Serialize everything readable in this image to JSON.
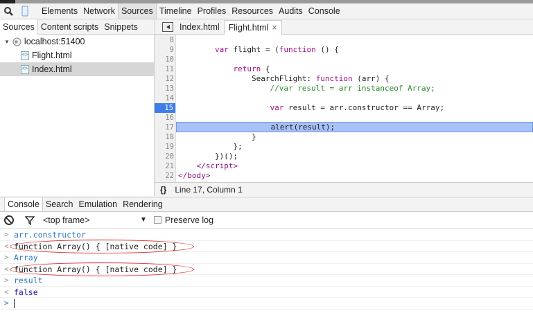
{
  "toolbar": {
    "tabs": [
      "Elements",
      "Network",
      "Sources",
      "Timeline",
      "Profiles",
      "Resources",
      "Audits",
      "Console"
    ],
    "active": "Sources"
  },
  "navigator": {
    "tabs": [
      "Sources",
      "Content scripts",
      "Snippets"
    ],
    "host": "localhost:51400",
    "files": [
      "Flight.html",
      "Index.html"
    ],
    "selected": "Index.html"
  },
  "editor": {
    "tabs": [
      "Index.html",
      "Flight.html"
    ],
    "active": "Flight.html",
    "close_glyph": "×",
    "breakpoint_line": 15,
    "execution_line": 17,
    "lines": [
      {
        "n": "8",
        "seg": []
      },
      {
        "n": "9",
        "seg": [
          [
            "p",
            "        "
          ],
          [
            "k",
            "var"
          ],
          [
            "p",
            " flight = ("
          ],
          [
            "k",
            "function"
          ],
          [
            "p",
            " () {"
          ]
        ]
      },
      {
        "n": "10",
        "seg": []
      },
      {
        "n": "11",
        "seg": [
          [
            "p",
            "            "
          ],
          [
            "k",
            "return"
          ],
          [
            "p",
            " {"
          ]
        ]
      },
      {
        "n": "12",
        "seg": [
          [
            "p",
            "                SearchFlight: "
          ],
          [
            "k",
            "function"
          ],
          [
            "p",
            " (arr) {"
          ]
        ]
      },
      {
        "n": "13",
        "seg": [
          [
            "p",
            "                    "
          ],
          [
            "c",
            "//var result = arr instanceof Array;"
          ]
        ]
      },
      {
        "n": "14",
        "seg": []
      },
      {
        "n": "15",
        "seg": [
          [
            "p",
            "                    "
          ],
          [
            "k",
            "var"
          ],
          [
            "p",
            " result = arr.constructor == Array;"
          ]
        ]
      },
      {
        "n": "16",
        "seg": []
      },
      {
        "n": "17",
        "seg": [
          [
            "p",
            "                    alert(result);"
          ]
        ]
      },
      {
        "n": "18",
        "seg": [
          [
            "p",
            "                }"
          ]
        ]
      },
      {
        "n": "19",
        "seg": [
          [
            "p",
            "            };"
          ]
        ]
      },
      {
        "n": "20",
        "seg": [
          [
            "p",
            "        })();"
          ]
        ]
      },
      {
        "n": "21",
        "seg": [
          [
            "p",
            "    "
          ],
          [
            "t",
            "</script>"
          ]
        ]
      },
      {
        "n": "22",
        "seg": [
          [
            "t",
            "</body>"
          ]
        ]
      }
    ]
  },
  "status": {
    "braces": "{}",
    "position": "Line 17, Column 1"
  },
  "drawer": {
    "tabs": [
      "Console",
      "Search",
      "Emulation",
      "Rendering"
    ],
    "active": "Console"
  },
  "console_toolbar": {
    "frame": "<top frame>",
    "preserve_log": "Preserve log",
    "preserve_checked": false
  },
  "console": [
    {
      "type": "in",
      "text": "arr.constructor"
    },
    {
      "type": "out",
      "text": "function Array() { [native code] }",
      "circled": true
    },
    {
      "type": "in",
      "text": "Array"
    },
    {
      "type": "out",
      "text": "function Array() { [native code] }",
      "circled": true
    },
    {
      "type": "in",
      "text": "result"
    },
    {
      "type": "bool",
      "text": "false"
    }
  ],
  "colors": {
    "breakpoint": "#3f7ee8",
    "exec_line": "#a8c1f7",
    "annotation": "#dd3333"
  }
}
